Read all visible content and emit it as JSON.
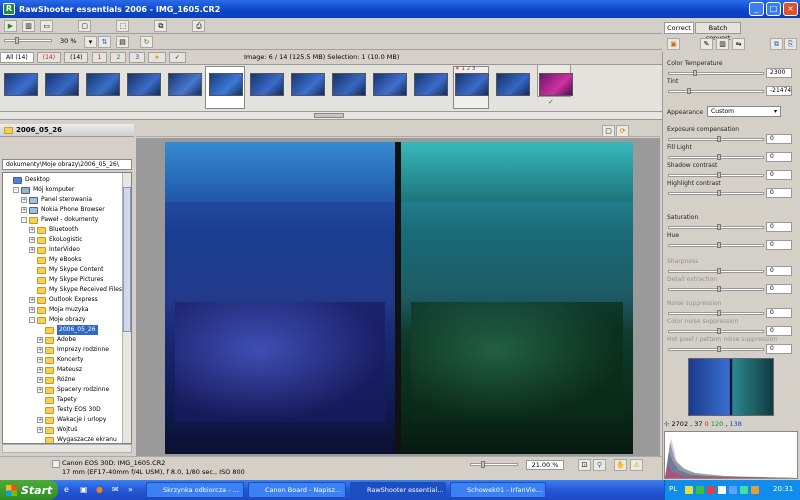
{
  "window": {
    "title": "RawShooter essentials 2006 - IMG_1605.CR2",
    "controls": [
      "_",
      "□",
      "×"
    ]
  },
  "toolbar": {
    "zoom_value": "30 %"
  },
  "filter_tabs": [
    "All (14)",
    "(14)",
    "1",
    "2",
    "3"
  ],
  "status": {
    "image_info": "Image: 6 / 14 (125.5 MB) Selection: 1 (10.0 MB)"
  },
  "thumbnail_rating_labels": [
    "1",
    "2",
    "3"
  ],
  "folder_panel": {
    "current_folder": "2006_05_26",
    "path_dropdown": "dokumenty\\Moje obrazy\\2006_05_26\\",
    "tree": [
      {
        "label": "Desktop",
        "level": 0,
        "expander": "",
        "type": "desktop"
      },
      {
        "label": "Mój komputer",
        "level": 1,
        "expander": "-",
        "type": "computer"
      },
      {
        "label": "Panel sterowania",
        "level": 2,
        "expander": "+",
        "type": "cpanel"
      },
      {
        "label": "Nokia Phone Browser",
        "level": 2,
        "expander": "+",
        "type": "phone"
      },
      {
        "label": "Paweł - dokumenty",
        "level": 2,
        "expander": "-",
        "type": "folder"
      },
      {
        "label": "Bluetooth",
        "level": 3,
        "expander": "+",
        "type": "folder"
      },
      {
        "label": "EkoLogistic",
        "level": 3,
        "expander": "+",
        "type": "folder"
      },
      {
        "label": "InterVideo",
        "level": 3,
        "expander": "+",
        "type": "folder"
      },
      {
        "label": "My eBooks",
        "level": 3,
        "expander": "",
        "type": "folder"
      },
      {
        "label": "My Skype Content",
        "level": 3,
        "expander": "",
        "type": "folder"
      },
      {
        "label": "My Skype Pictures",
        "level": 3,
        "expander": "",
        "type": "folder"
      },
      {
        "label": "My Skype Received Files",
        "level": 3,
        "expander": "",
        "type": "folder"
      },
      {
        "label": "Outlook Express",
        "level": 3,
        "expander": "+",
        "type": "folder"
      },
      {
        "label": "Moja muzyka",
        "level": 3,
        "expander": "+",
        "type": "folder"
      },
      {
        "label": "Moje obrazy",
        "level": 3,
        "expander": "-",
        "type": "folder"
      },
      {
        "label": "2006_05_26",
        "level": 4,
        "expander": "",
        "type": "folder",
        "selected": true
      },
      {
        "label": "Adobe",
        "level": 4,
        "expander": "+",
        "type": "folder"
      },
      {
        "label": "Imprezy rodzinne",
        "level": 4,
        "expander": "+",
        "type": "folder"
      },
      {
        "label": "Koncerty",
        "level": 4,
        "expander": "+",
        "type": "folder"
      },
      {
        "label": "Mateusz",
        "level": 4,
        "expander": "+",
        "type": "folder"
      },
      {
        "label": "Różne",
        "level": 4,
        "expander": "+",
        "type": "folder"
      },
      {
        "label": "Spacery rodzinne",
        "level": 4,
        "expander": "+",
        "type": "folder"
      },
      {
        "label": "Tapety",
        "level": 4,
        "expander": "",
        "type": "folder"
      },
      {
        "label": "Testy EOS 30D",
        "level": 4,
        "expander": "",
        "type": "folder"
      },
      {
        "label": "Wakacje i urlopy",
        "level": 4,
        "expander": "+",
        "type": "folder"
      },
      {
        "label": "Wojtuś",
        "level": 4,
        "expander": "+",
        "type": "folder"
      },
      {
        "label": "Wygaszacze ekranu",
        "level": 4,
        "expander": "",
        "type": "folder"
      }
    ]
  },
  "image_info": {
    "camera_line": "Canon EOS 30D:  IMG_1605.CR2",
    "exif_line": "17 mm (EF17-40mm f/4L USM), f 8.0, 1/80 sec., ISO 800"
  },
  "view": {
    "zoom_display": "21.00 %"
  },
  "right_panel": {
    "tabs": [
      "Correct",
      "Batch convert"
    ],
    "controls": [
      {
        "label": "Color Temperature",
        "value": "2300",
        "dim": false
      },
      {
        "label": "Tint",
        "value": "-21474",
        "dim": false
      },
      {
        "label": "Exposure compensation",
        "value": "0",
        "dim": false
      },
      {
        "label": "Fill Light",
        "value": "0",
        "dim": false
      },
      {
        "label": "Shadow contrast",
        "value": "0",
        "dim": false
      },
      {
        "label": "Highlight contrast",
        "value": "0",
        "dim": false
      },
      {
        "label": "Saturation",
        "value": "0",
        "dim": false
      },
      {
        "label": "Hue",
        "value": "0",
        "dim": false
      },
      {
        "label": "Sharpness",
        "value": "0",
        "dim": true
      },
      {
        "label": "Detail extraction",
        "value": "0",
        "dim": true
      },
      {
        "label": "Noise suppression",
        "value": "0",
        "dim": true
      },
      {
        "label": "Color noise suppression",
        "value": "0",
        "dim": true
      },
      {
        "label": "Hot pixel / pattern noise suppression",
        "value": "0",
        "dim": true
      }
    ],
    "appearance": {
      "label": "Appearance",
      "value": "Custom"
    },
    "pixel_readout": {
      "x": "2702",
      "y": "37",
      "r": "0",
      "g": "120",
      "b": "138"
    }
  },
  "taskbar": {
    "start_label": "Start",
    "items": [
      {
        "label": "Skrzynka odbiorcza - ...",
        "active": false
      },
      {
        "label": "Canon Board - Napisz...",
        "active": false
      },
      {
        "label": "RawShooter essential...",
        "active": true
      },
      {
        "label": "Schowek01 - IrfanVie...",
        "active": false
      }
    ],
    "language": "PL",
    "clock": "20:31"
  },
  "colors": {
    "title_blue": "#0b45c9",
    "xp_taskbar": "#2457d6",
    "start_green": "#3a9b2f",
    "selection_blue": "#316ac5",
    "image_bg": "#9a9a9a"
  }
}
